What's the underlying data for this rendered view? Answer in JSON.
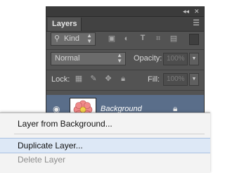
{
  "panel": {
    "top_controls": {
      "collapse": "◂◂",
      "close": "✕"
    },
    "tab_label": "Layers",
    "menu_icon": "hamburger-icon",
    "filter": {
      "value": "Kind",
      "icons": [
        "image-filter-icon",
        "adjustment-filter-icon",
        "type-filter-icon",
        "shape-filter-icon",
        "smart-object-filter-icon"
      ]
    },
    "blend_mode": "Normal",
    "opacity": {
      "label": "Opacity:",
      "value": "100%"
    },
    "lock": {
      "label": "Lock:",
      "icons": [
        "lock-transparency-icon",
        "lock-pixels-icon",
        "lock-position-icon",
        "lock-all-icon"
      ]
    },
    "fill": {
      "label": "Fill:",
      "value": "100%"
    },
    "layers": [
      {
        "name": "Background",
        "visible": true,
        "locked": true,
        "selected": true
      }
    ],
    "colors": {
      "panel": "#535353",
      "selected_row": "#5a6e8a"
    }
  },
  "context_menu": {
    "items": [
      {
        "label": "Layer from Background...",
        "state": "normal"
      },
      {
        "label": "Duplicate Layer...",
        "state": "hover"
      },
      {
        "label": "Delete Layer",
        "state": "disabled"
      }
    ],
    "colors": {
      "background": "#f3f3f3",
      "hover": "#dde8f6"
    }
  }
}
